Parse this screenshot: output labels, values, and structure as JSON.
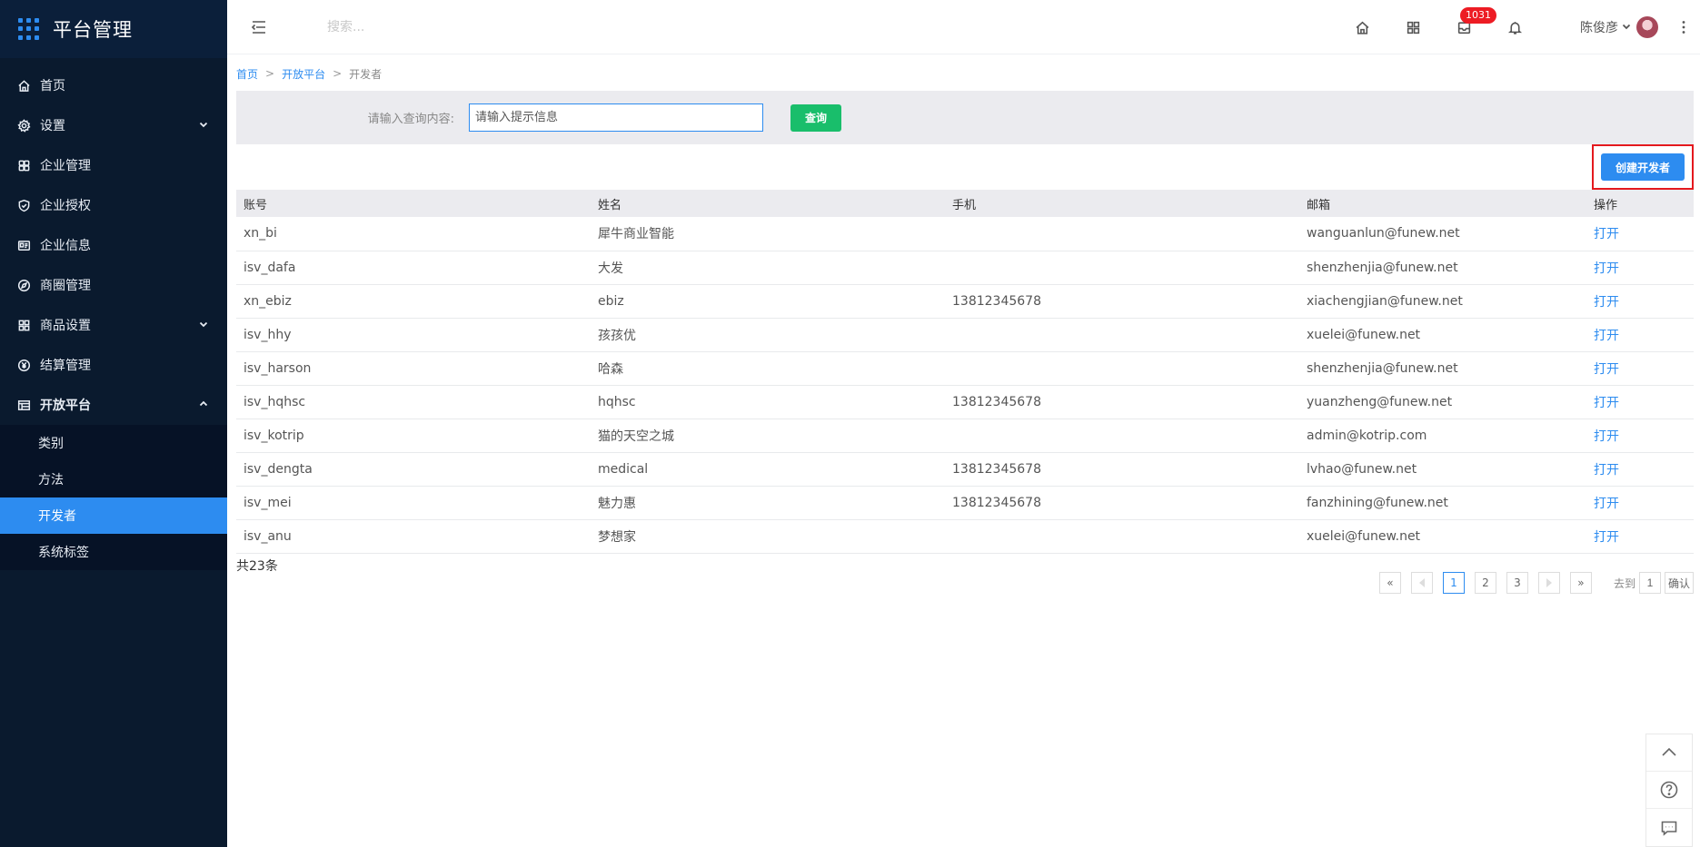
{
  "app": {
    "title": "平台管理"
  },
  "sidebar": {
    "items": [
      {
        "label": "首页",
        "icon": "home-icon"
      },
      {
        "label": "设置",
        "icon": "gear-icon",
        "expandable": true
      },
      {
        "label": "企业管理",
        "icon": "building-icon"
      },
      {
        "label": "企业授权",
        "icon": "shield-icon"
      },
      {
        "label": "企业信息",
        "icon": "id-card-icon"
      },
      {
        "label": "商圈管理",
        "icon": "compass-icon"
      },
      {
        "label": "商品设置",
        "icon": "grid-icon",
        "expandable": true
      },
      {
        "label": "结算管理",
        "icon": "yen-icon"
      },
      {
        "label": "开放平台",
        "icon": "table-icon",
        "expanded": true
      }
    ],
    "submenu": [
      {
        "label": "类别"
      },
      {
        "label": "方法"
      },
      {
        "label": "开发者",
        "active": true
      },
      {
        "label": "系统标签"
      }
    ]
  },
  "topbar": {
    "search_placeholder": "搜索...",
    "badge_count": "1031",
    "user_name": "陈俊彦"
  },
  "breadcrumb": {
    "home": "首页",
    "section": "开放平台",
    "current": "开发者",
    "separator": ">"
  },
  "query": {
    "label": "请输入查询内容:",
    "placeholder": "请输入提示信息",
    "button": "查询"
  },
  "create_button": "创建开发者",
  "table": {
    "headers": [
      "账号",
      "姓名",
      "手机",
      "邮箱",
      "操作"
    ],
    "rows": [
      [
        "xn_bi",
        "犀牛商业智能",
        "",
        "wanguanlun@funew.net",
        "打开"
      ],
      [
        "isv_dafa",
        "大发",
        "",
        "shenzhenjia@funew.net",
        "打开"
      ],
      [
        "xn_ebiz",
        "ebiz",
        "13812345678",
        "xiachengjian@funew.net",
        "打开"
      ],
      [
        "isv_hhy",
        "孩孩优",
        "",
        "xuelei@funew.net",
        "打开"
      ],
      [
        "isv_harson",
        "哈森",
        "",
        "shenzhenjia@funew.net",
        "打开"
      ],
      [
        "isv_hqhsc",
        "hqhsc",
        "13812345678",
        "yuanzheng@funew.net",
        "打开"
      ],
      [
        "isv_kotrip",
        "猫的天空之城",
        "",
        "admin@kotrip.com",
        "打开"
      ],
      [
        "isv_dengta",
        "medical",
        "13812345678",
        "lvhao@funew.net",
        "打开"
      ],
      [
        "isv_mei",
        "魅力惠",
        "13812345678",
        "fanzhining@funew.net",
        "打开"
      ],
      [
        "isv_anu",
        "梦想家",
        "",
        "xuelei@funew.net",
        "打开"
      ]
    ],
    "total": "共23条"
  },
  "pagination": {
    "first": "«",
    "last": "»",
    "pages": [
      "1",
      "2",
      "3"
    ],
    "current_page": "1",
    "goto_label": "去到",
    "goto_value": "1",
    "confirm": "确认"
  },
  "colors": {
    "sidebar_bg": "#0a1a2e",
    "accent": "#2d8cf0",
    "query_button": "#19be6b",
    "badge": "#ed1c24",
    "highlight_border": "#e4191e"
  }
}
